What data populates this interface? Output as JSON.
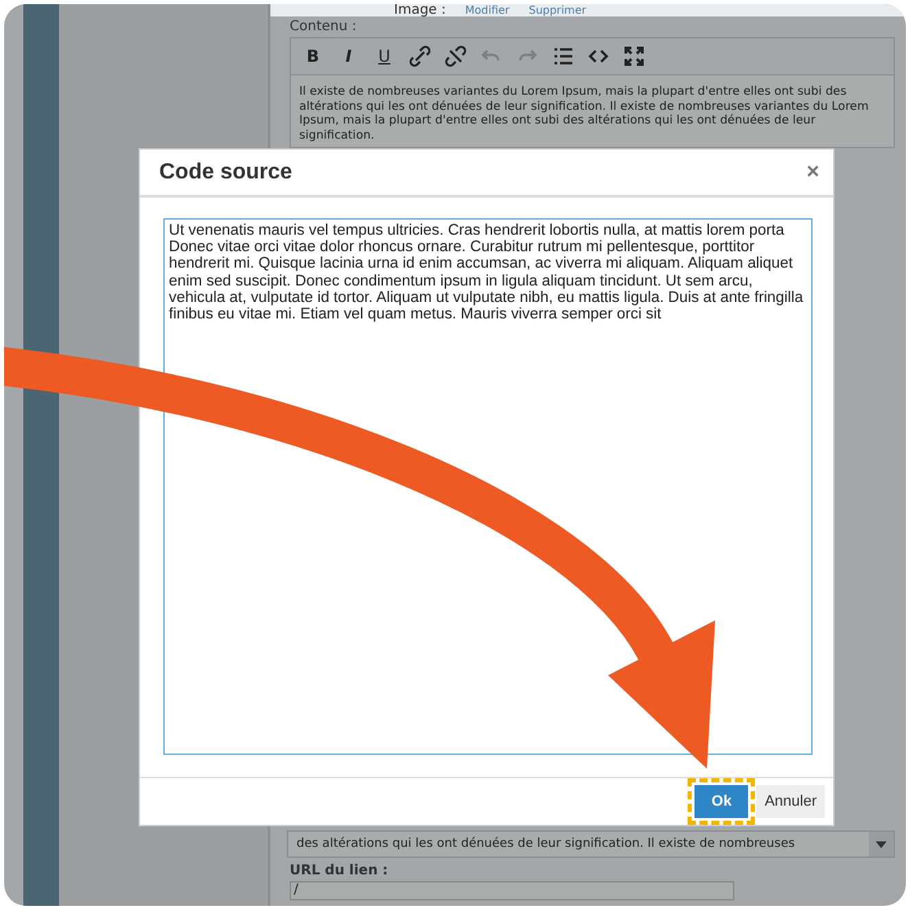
{
  "background_page": {
    "image_row": {
      "label": "Image :",
      "links": [
        "Modifier",
        "Supprimer"
      ]
    },
    "content_label": "Contenu :",
    "editor": {
      "toolbar": [
        {
          "kind": "bold",
          "label": "B",
          "disabled": false
        },
        {
          "kind": "italic",
          "label": "I",
          "disabled": false
        },
        {
          "kind": "underline",
          "label": "U",
          "disabled": false
        },
        {
          "kind": "link",
          "disabled": false
        },
        {
          "kind": "unlink",
          "disabled": false
        },
        {
          "kind": "undo",
          "disabled": true
        },
        {
          "kind": "redo",
          "disabled": true
        },
        {
          "kind": "list",
          "disabled": false
        },
        {
          "kind": "code",
          "disabled": false
        },
        {
          "kind": "fullscreen",
          "disabled": false
        }
      ],
      "text": "Il existe de nombreuses variantes du Lorem Ipsum, mais la plupart d'entre elles ont subi des altérations qui les ont dénuées de leur signification. Il existe de nombreuses variantes du Lorem Ipsum, mais la plupart d'entre elles ont subi des altérations qui les ont dénuées de leur signification."
    },
    "lower_editor_line": "des altérations qui les ont dénuées de leur signification. Il existe de nombreuses",
    "url_label": "URL du lien :",
    "url_value": "/"
  },
  "dialog": {
    "title": "Code source",
    "close": "×",
    "source_text": "Ut venenatis mauris vel tempus ultricies. Cras hendrerit lobortis nulla, at mattis lorem porta Donec vitae orci vitae dolor rhoncus ornare. Curabitur rutrum mi pellentesque, porttitor hendrerit mi. Quisque lacinia urna id enim accumsan, ac viverra mi aliquam. Aliquam aliquet enim sed suscipit. Donec condimentum ipsum in ligula aliquam tincidunt. Ut sem arcu, vehicula at, vulputate id tortor. Aliquam ut vulputate nibh, eu mattis ligula. Duis at ante fringilla finibus eu vitae mi. Etiam vel quam metus. Mauris viverra semper orci sit",
    "buttons": [
      {
        "label": "Ok",
        "kind": "primary",
        "highlighted": true
      },
      {
        "label": "Annuler",
        "kind": "secondary",
        "highlighted": false
      }
    ]
  }
}
